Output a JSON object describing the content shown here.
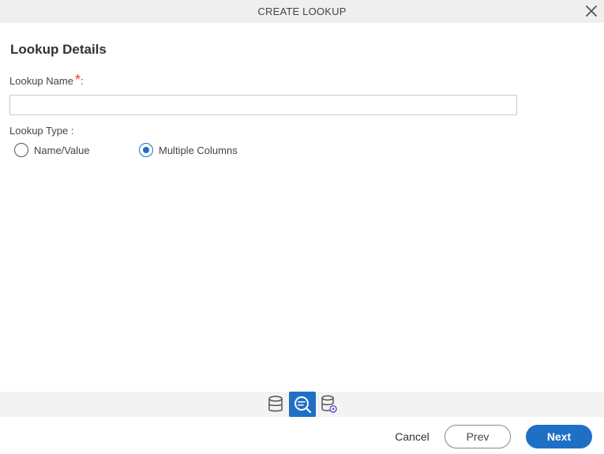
{
  "dialog": {
    "title": "CREATE LOOKUP",
    "close_icon": "close-icon"
  },
  "section": {
    "title": "Lookup Details"
  },
  "lookup_name": {
    "label": "Lookup Name",
    "required_mark": "*",
    "suffix": ":",
    "value": "",
    "placeholder": ""
  },
  "lookup_type": {
    "label": "Lookup Type :",
    "options": [
      {
        "label": "Name/Value",
        "selected": false
      },
      {
        "label": "Multiple Columns",
        "selected": true
      }
    ]
  },
  "steps": [
    {
      "icon": "database-icon",
      "active": false
    },
    {
      "icon": "lookup-search-icon",
      "active": true
    },
    {
      "icon": "database-settings-icon",
      "active": false
    }
  ],
  "footer": {
    "cancel_label": "Cancel",
    "prev_label": "Prev",
    "next_label": "Next"
  },
  "colors": {
    "accent": "#1f6fc5",
    "required": "#e63b2e",
    "title_bar": "#efefef"
  }
}
